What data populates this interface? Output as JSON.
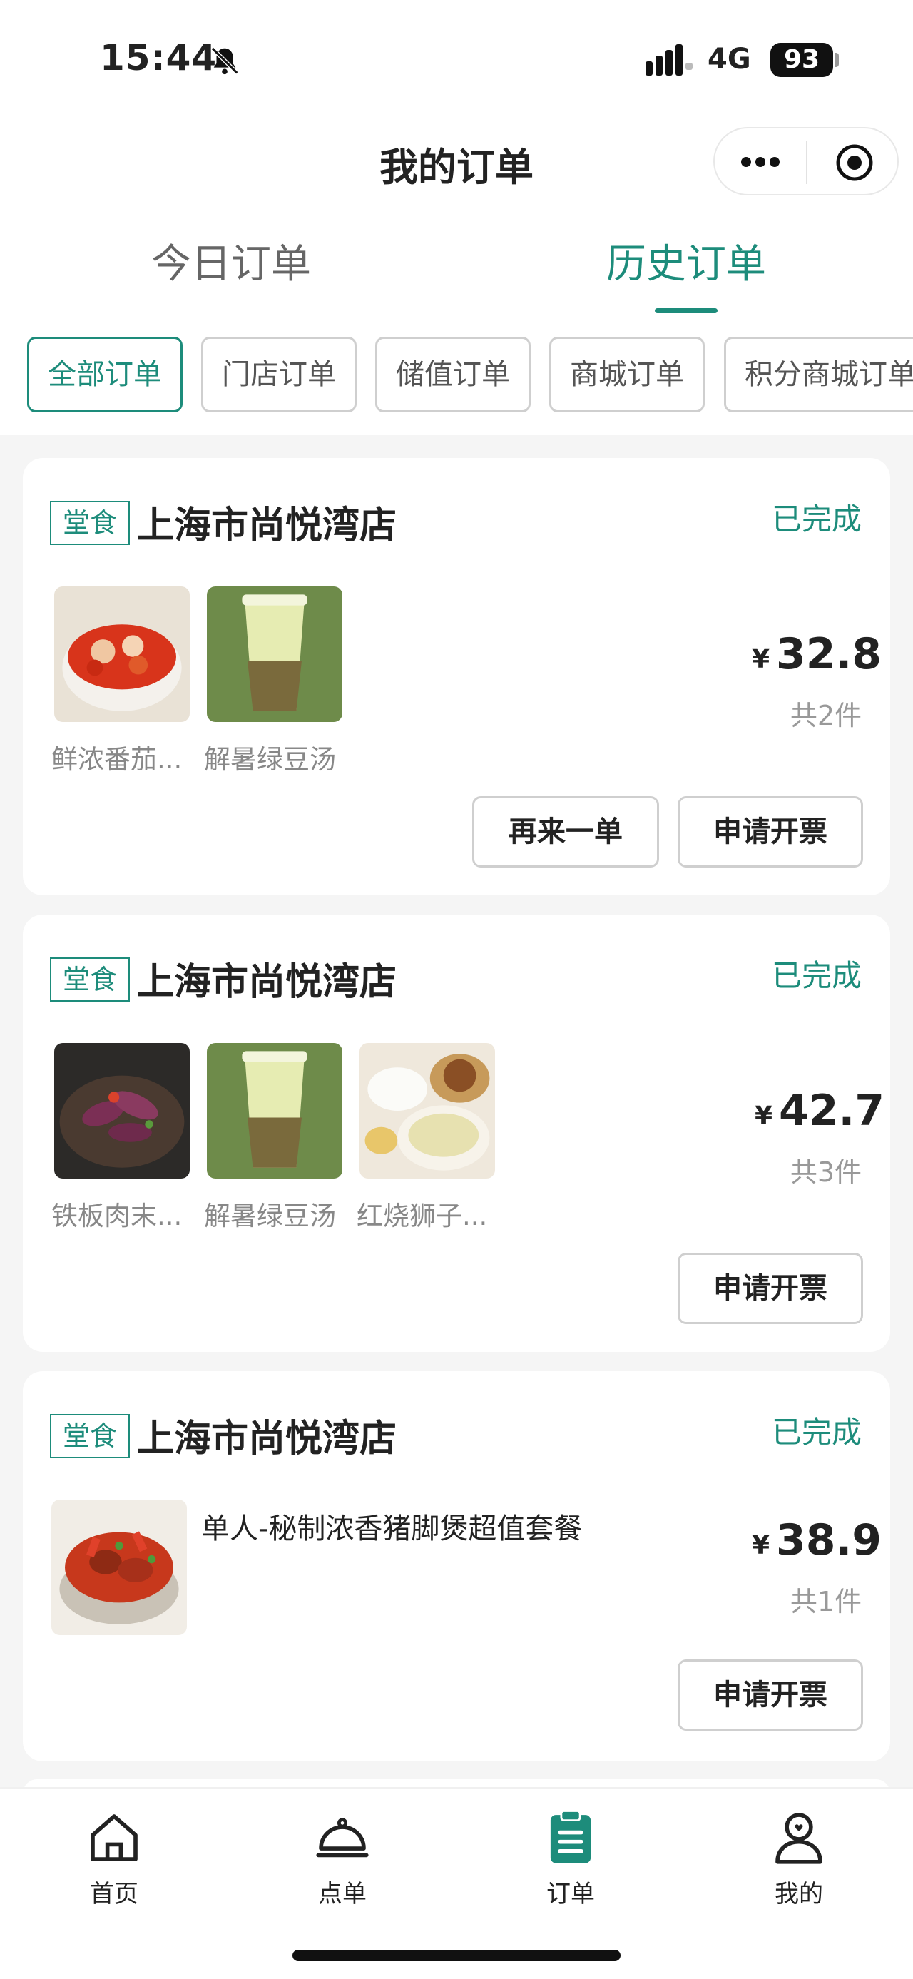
{
  "status_bar": {
    "time": "15:44",
    "network": "4G",
    "battery": "93"
  },
  "header": {
    "title": "我的订单"
  },
  "tabs": [
    {
      "label": "今日订单",
      "active": false
    },
    {
      "label": "历史订单",
      "active": true
    }
  ],
  "filters": [
    {
      "label": "全部订单",
      "active": true
    },
    {
      "label": "门店订单",
      "active": false
    },
    {
      "label": "储值订单",
      "active": false
    },
    {
      "label": "商城订单",
      "active": false
    },
    {
      "label": "积分商城订单",
      "active": false
    }
  ],
  "orders": [
    {
      "badge": "堂食",
      "store": "上海市尚悦湾店",
      "status": "已完成",
      "items": [
        {
          "name": "鲜浓番茄...",
          "icon": "tomato-dish"
        },
        {
          "name": "解暑绿豆汤",
          "icon": "mung-bean-soup"
        }
      ],
      "currency": "¥",
      "price": "32.8",
      "count": "共2件",
      "buttons": [
        "再来一单",
        "申请开票"
      ]
    },
    {
      "badge": "堂食",
      "store": "上海市尚悦湾店",
      "status": "已完成",
      "items": [
        {
          "name": "铁板肉末...",
          "icon": "eggplant-dish"
        },
        {
          "name": "解暑绿豆汤",
          "icon": "mung-bean-soup"
        },
        {
          "name": "红烧狮子...",
          "icon": "meatball-set"
        }
      ],
      "currency": "¥",
      "price": "42.7",
      "count": "共3件",
      "buttons": [
        "申请开票"
      ]
    },
    {
      "badge": "堂食",
      "store": "上海市尚悦湾店",
      "status": "已完成",
      "items": [
        {
          "name": "单人-秘制浓香猪脚煲超值套餐",
          "icon": "pork-trotter-pot"
        }
      ],
      "currency": "¥",
      "price": "38.9",
      "count": "共1件",
      "buttons": [
        "申请开票"
      ]
    }
  ],
  "bottom_nav": [
    {
      "label": "首页",
      "icon": "home-icon",
      "active": false
    },
    {
      "label": "点单",
      "icon": "cloche-icon",
      "active": false
    },
    {
      "label": "订单",
      "icon": "clipboard-icon",
      "active": true
    },
    {
      "label": "我的",
      "icon": "profile-icon",
      "active": false
    }
  ],
  "colors": {
    "accent": "#1d8c7b",
    "background": "#f5f5f5"
  }
}
